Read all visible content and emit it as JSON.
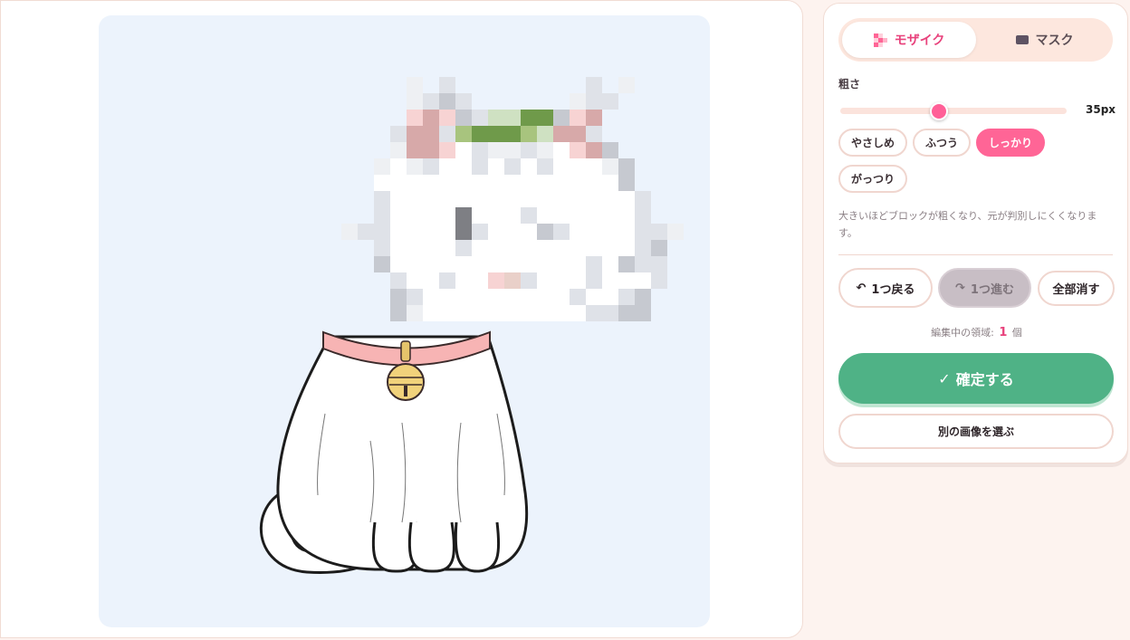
{
  "tabs": {
    "mosaic": "モザイク",
    "mask": "マスク",
    "active": "mosaic"
  },
  "coarseness": {
    "label": "粗さ",
    "value_label": "35px",
    "value": 35,
    "min": 5,
    "max": 100
  },
  "presets": [
    {
      "label": "やさしめ",
      "active": false
    },
    {
      "label": "ふつう",
      "active": false
    },
    {
      "label": "しっかり",
      "active": true
    },
    {
      "label": "がっつり",
      "active": false
    }
  ],
  "hint": "大きいほどブロックが粗くなり、元が判別しにくくなります。",
  "actions": {
    "undo": "1つ戻る",
    "redo": "1つ進む",
    "clear": "全部消す"
  },
  "counter": {
    "prefix": "編集中の領域:",
    "count": "1",
    "suffix": "個"
  },
  "confirm_label": "確定する",
  "choose_label": "別の画像を選ぶ",
  "colors": {
    "accent": "#ff6596",
    "confirm": "#4fb286",
    "canvas_bg": "#ecf3fc",
    "page_bg": "#fdf3ef"
  }
}
